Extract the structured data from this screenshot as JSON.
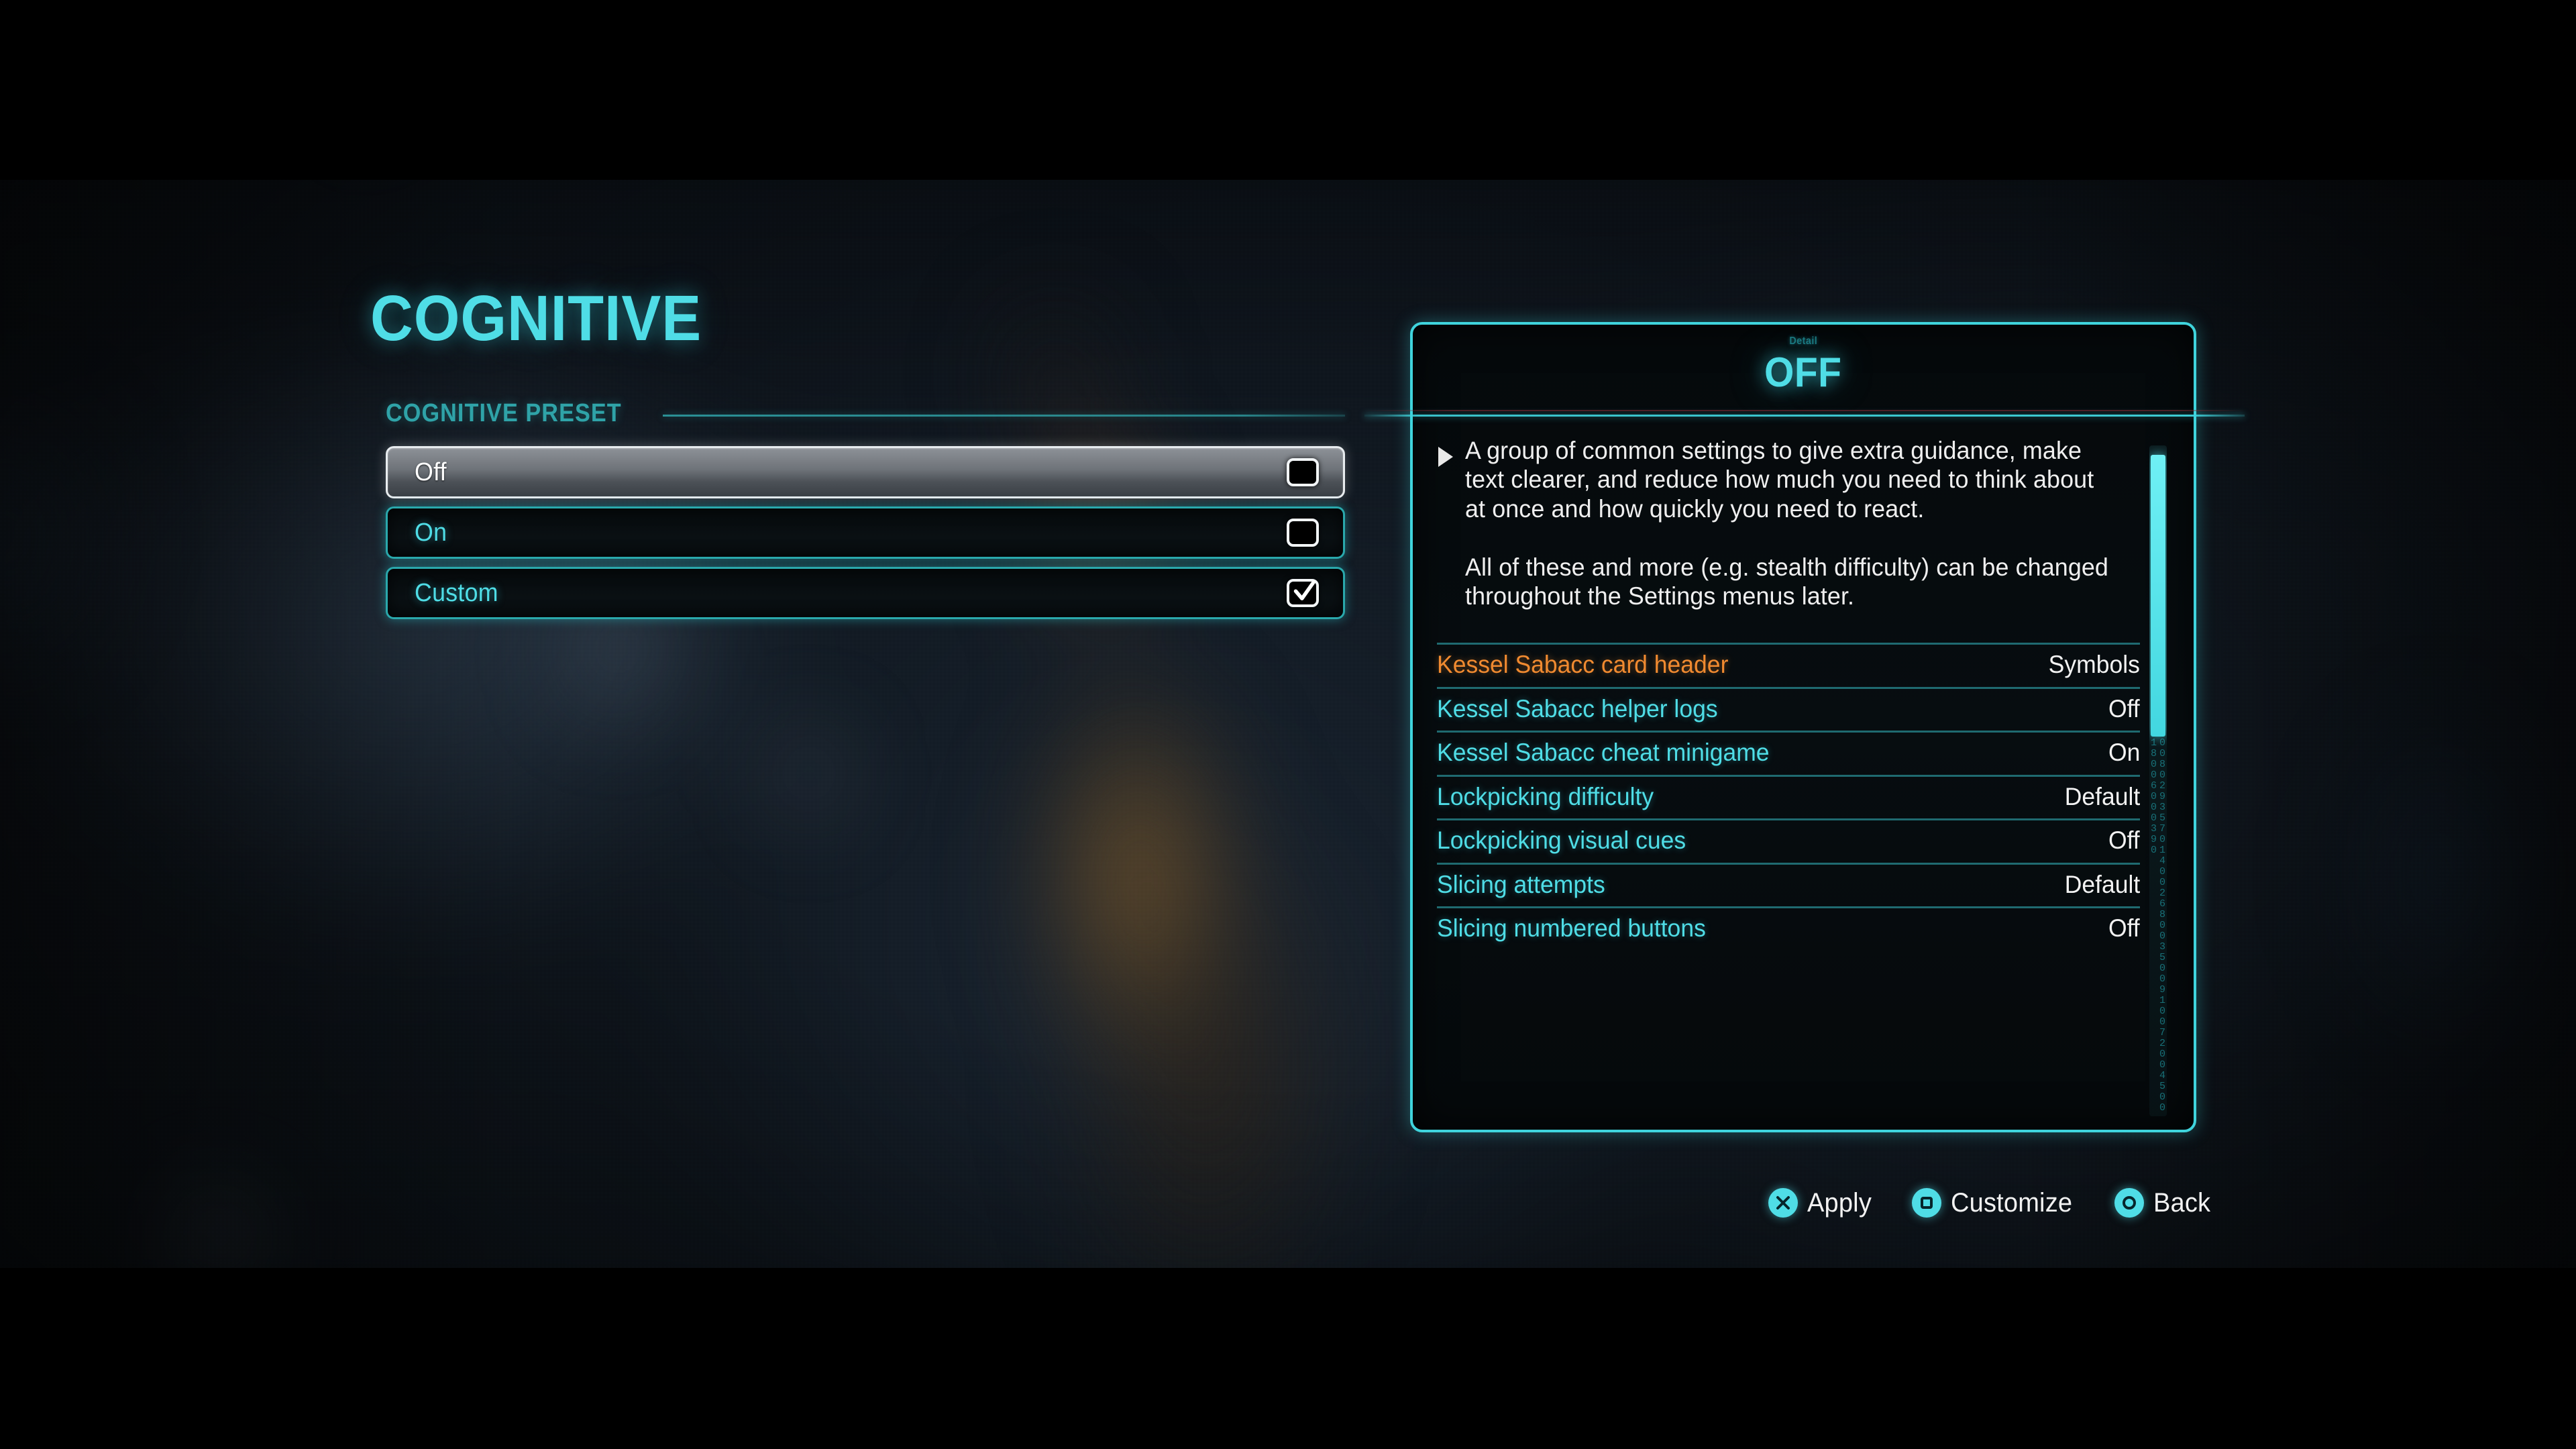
{
  "screen": {
    "title": "COGNITIVE"
  },
  "preset_section": {
    "header": "COGNITIVE PRESET",
    "options": [
      {
        "label": "Off",
        "checked": false,
        "selected": true
      },
      {
        "label": "On",
        "checked": false,
        "selected": false
      },
      {
        "label": "Custom",
        "checked": true,
        "selected": false
      }
    ]
  },
  "detail_panel": {
    "kicker": "Detail",
    "title": "OFF",
    "arrow_icon": "triangle-right-icon",
    "description": [
      "A group of common settings to give extra guidance, make text clearer, and reduce how much you need to think about at once and how quickly you need to react.",
      "All of these and more (e.g. stealth difficulty) can be changed throughout the Settings menus later."
    ],
    "settings": [
      {
        "name": "Kessel Sabacc card header",
        "value": "Symbols",
        "highlight": true
      },
      {
        "name": "Kessel Sabacc helper logs",
        "value": "Off",
        "highlight": false
      },
      {
        "name": "Kessel Sabacc cheat minigame",
        "value": "On",
        "highlight": false
      },
      {
        "name": "Lockpicking difficulty",
        "value": "Default",
        "highlight": false
      },
      {
        "name": "Lockpicking visual cues",
        "value": "Off",
        "highlight": false
      },
      {
        "name": "Slicing attempts",
        "value": "Default",
        "highlight": false
      },
      {
        "name": "Slicing numbered buttons",
        "value": "Off",
        "highlight": false
      }
    ],
    "scrollbar_digits": "0080293570140026800350091007200450018006000390"
  },
  "prompts": [
    {
      "label": "Apply",
      "icon": "cross-button-icon"
    },
    {
      "label": "Customize",
      "icon": "square-button-icon"
    },
    {
      "label": "Back",
      "icon": "circle-button-icon"
    }
  ],
  "colors": {
    "accent_cyan": "#4fdde6",
    "accent_teal": "#2aa8ac",
    "highlight_orange": "#f08a30",
    "value_white": "#f2f2f2"
  }
}
